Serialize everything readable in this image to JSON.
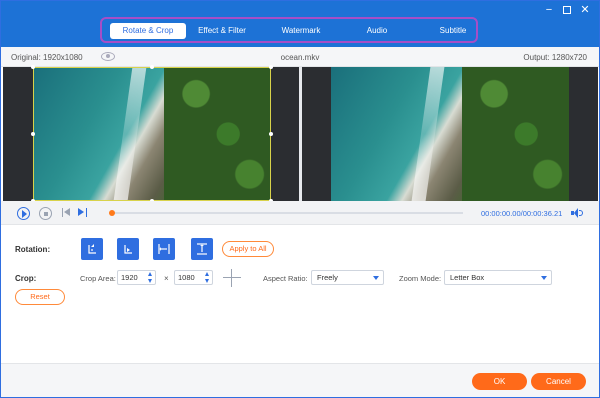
{
  "window": {
    "controls": {
      "minimize": "minimize-icon",
      "maximize": "maximize-icon",
      "close": "close-icon"
    }
  },
  "tabs": [
    {
      "label": "Rotate & Crop",
      "active": true
    },
    {
      "label": "Effect & Filter",
      "active": false
    },
    {
      "label": "Watermark",
      "active": false
    },
    {
      "label": "Audio",
      "active": false
    },
    {
      "label": "Subtitle",
      "active": false
    }
  ],
  "infobar": {
    "original": "Original: 1920x1080",
    "filename": "ocean.mkv",
    "output": "Output: 1280x720"
  },
  "player": {
    "time_current": "00:00:00.00",
    "time_total": "/00:00:36.21",
    "progress": 0.0
  },
  "rotation": {
    "label": "Rotation:",
    "buttons": [
      "rotate-left-icon",
      "rotate-right-icon",
      "flip-horizontal-icon",
      "flip-vertical-icon"
    ],
    "apply_all": "Apply to All"
  },
  "crop": {
    "label": "Crop:",
    "area_label": "Crop Area:",
    "width": "1920",
    "height": "1080",
    "times": "×",
    "aspect_label": "Aspect Ratio:",
    "aspect_value": "Freely",
    "zoom_label": "Zoom Mode:",
    "zoom_value": "Letter Box",
    "reset": "Reset"
  },
  "footer": {
    "ok": "OK",
    "cancel": "Cancel"
  },
  "colors": {
    "accent": "#1d72d6",
    "orange": "#ff6a1a",
    "tab_outline": "#a64ec7"
  }
}
